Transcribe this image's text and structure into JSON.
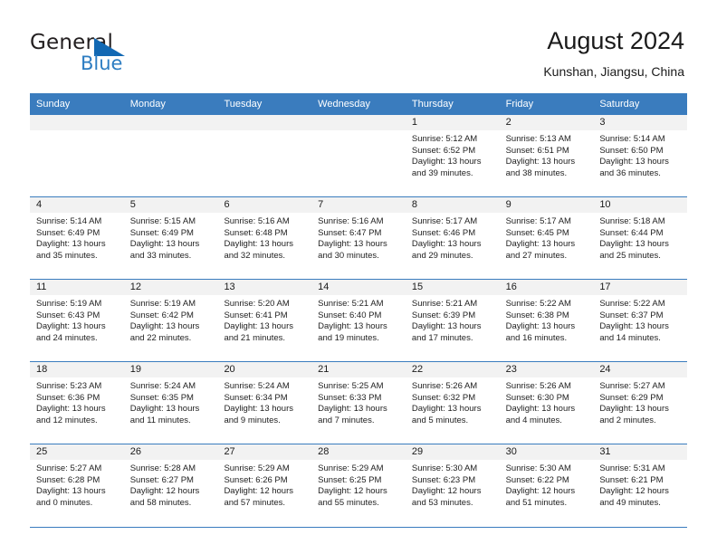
{
  "brand": {
    "name_part1": "General",
    "name_part2": "Blue",
    "logo_icon": "blue-triangle-icon",
    "accent_color": "#1268b3",
    "text_color": "#231f20"
  },
  "header": {
    "title": "August 2024",
    "subtitle": "Kunshan, Jiangsu, China"
  },
  "calendar": {
    "header_bg": "#3a7cbe",
    "header_text_color": "#ffffff",
    "daynum_bg": "#f2f2f2",
    "weekdays": [
      "Sunday",
      "Monday",
      "Tuesday",
      "Wednesday",
      "Thursday",
      "Friday",
      "Saturday"
    ],
    "weeks": [
      [
        {
          "day": "",
          "sunrise": "",
          "sunset": "",
          "daylight1": "",
          "daylight2": ""
        },
        {
          "day": "",
          "sunrise": "",
          "sunset": "",
          "daylight1": "",
          "daylight2": ""
        },
        {
          "day": "",
          "sunrise": "",
          "sunset": "",
          "daylight1": "",
          "daylight2": ""
        },
        {
          "day": "",
          "sunrise": "",
          "sunset": "",
          "daylight1": "",
          "daylight2": ""
        },
        {
          "day": "1",
          "sunrise": "Sunrise: 5:12 AM",
          "sunset": "Sunset: 6:52 PM",
          "daylight1": "Daylight: 13 hours",
          "daylight2": "and 39 minutes."
        },
        {
          "day": "2",
          "sunrise": "Sunrise: 5:13 AM",
          "sunset": "Sunset: 6:51 PM",
          "daylight1": "Daylight: 13 hours",
          "daylight2": "and 38 minutes."
        },
        {
          "day": "3",
          "sunrise": "Sunrise: 5:14 AM",
          "sunset": "Sunset: 6:50 PM",
          "daylight1": "Daylight: 13 hours",
          "daylight2": "and 36 minutes."
        }
      ],
      [
        {
          "day": "4",
          "sunrise": "Sunrise: 5:14 AM",
          "sunset": "Sunset: 6:49 PM",
          "daylight1": "Daylight: 13 hours",
          "daylight2": "and 35 minutes."
        },
        {
          "day": "5",
          "sunrise": "Sunrise: 5:15 AM",
          "sunset": "Sunset: 6:49 PM",
          "daylight1": "Daylight: 13 hours",
          "daylight2": "and 33 minutes."
        },
        {
          "day": "6",
          "sunrise": "Sunrise: 5:16 AM",
          "sunset": "Sunset: 6:48 PM",
          "daylight1": "Daylight: 13 hours",
          "daylight2": "and 32 minutes."
        },
        {
          "day": "7",
          "sunrise": "Sunrise: 5:16 AM",
          "sunset": "Sunset: 6:47 PM",
          "daylight1": "Daylight: 13 hours",
          "daylight2": "and 30 minutes."
        },
        {
          "day": "8",
          "sunrise": "Sunrise: 5:17 AM",
          "sunset": "Sunset: 6:46 PM",
          "daylight1": "Daylight: 13 hours",
          "daylight2": "and 29 minutes."
        },
        {
          "day": "9",
          "sunrise": "Sunrise: 5:17 AM",
          "sunset": "Sunset: 6:45 PM",
          "daylight1": "Daylight: 13 hours",
          "daylight2": "and 27 minutes."
        },
        {
          "day": "10",
          "sunrise": "Sunrise: 5:18 AM",
          "sunset": "Sunset: 6:44 PM",
          "daylight1": "Daylight: 13 hours",
          "daylight2": "and 25 minutes."
        }
      ],
      [
        {
          "day": "11",
          "sunrise": "Sunrise: 5:19 AM",
          "sunset": "Sunset: 6:43 PM",
          "daylight1": "Daylight: 13 hours",
          "daylight2": "and 24 minutes."
        },
        {
          "day": "12",
          "sunrise": "Sunrise: 5:19 AM",
          "sunset": "Sunset: 6:42 PM",
          "daylight1": "Daylight: 13 hours",
          "daylight2": "and 22 minutes."
        },
        {
          "day": "13",
          "sunrise": "Sunrise: 5:20 AM",
          "sunset": "Sunset: 6:41 PM",
          "daylight1": "Daylight: 13 hours",
          "daylight2": "and 21 minutes."
        },
        {
          "day": "14",
          "sunrise": "Sunrise: 5:21 AM",
          "sunset": "Sunset: 6:40 PM",
          "daylight1": "Daylight: 13 hours",
          "daylight2": "and 19 minutes."
        },
        {
          "day": "15",
          "sunrise": "Sunrise: 5:21 AM",
          "sunset": "Sunset: 6:39 PM",
          "daylight1": "Daylight: 13 hours",
          "daylight2": "and 17 minutes."
        },
        {
          "day": "16",
          "sunrise": "Sunrise: 5:22 AM",
          "sunset": "Sunset: 6:38 PM",
          "daylight1": "Daylight: 13 hours",
          "daylight2": "and 16 minutes."
        },
        {
          "day": "17",
          "sunrise": "Sunrise: 5:22 AM",
          "sunset": "Sunset: 6:37 PM",
          "daylight1": "Daylight: 13 hours",
          "daylight2": "and 14 minutes."
        }
      ],
      [
        {
          "day": "18",
          "sunrise": "Sunrise: 5:23 AM",
          "sunset": "Sunset: 6:36 PM",
          "daylight1": "Daylight: 13 hours",
          "daylight2": "and 12 minutes."
        },
        {
          "day": "19",
          "sunrise": "Sunrise: 5:24 AM",
          "sunset": "Sunset: 6:35 PM",
          "daylight1": "Daylight: 13 hours",
          "daylight2": "and 11 minutes."
        },
        {
          "day": "20",
          "sunrise": "Sunrise: 5:24 AM",
          "sunset": "Sunset: 6:34 PM",
          "daylight1": "Daylight: 13 hours",
          "daylight2": "and 9 minutes."
        },
        {
          "day": "21",
          "sunrise": "Sunrise: 5:25 AM",
          "sunset": "Sunset: 6:33 PM",
          "daylight1": "Daylight: 13 hours",
          "daylight2": "and 7 minutes."
        },
        {
          "day": "22",
          "sunrise": "Sunrise: 5:26 AM",
          "sunset": "Sunset: 6:32 PM",
          "daylight1": "Daylight: 13 hours",
          "daylight2": "and 5 minutes."
        },
        {
          "day": "23",
          "sunrise": "Sunrise: 5:26 AM",
          "sunset": "Sunset: 6:30 PM",
          "daylight1": "Daylight: 13 hours",
          "daylight2": "and 4 minutes."
        },
        {
          "day": "24",
          "sunrise": "Sunrise: 5:27 AM",
          "sunset": "Sunset: 6:29 PM",
          "daylight1": "Daylight: 13 hours",
          "daylight2": "and 2 minutes."
        }
      ],
      [
        {
          "day": "25",
          "sunrise": "Sunrise: 5:27 AM",
          "sunset": "Sunset: 6:28 PM",
          "daylight1": "Daylight: 13 hours",
          "daylight2": "and 0 minutes."
        },
        {
          "day": "26",
          "sunrise": "Sunrise: 5:28 AM",
          "sunset": "Sunset: 6:27 PM",
          "daylight1": "Daylight: 12 hours",
          "daylight2": "and 58 minutes."
        },
        {
          "day": "27",
          "sunrise": "Sunrise: 5:29 AM",
          "sunset": "Sunset: 6:26 PM",
          "daylight1": "Daylight: 12 hours",
          "daylight2": "and 57 minutes."
        },
        {
          "day": "28",
          "sunrise": "Sunrise: 5:29 AM",
          "sunset": "Sunset: 6:25 PM",
          "daylight1": "Daylight: 12 hours",
          "daylight2": "and 55 minutes."
        },
        {
          "day": "29",
          "sunrise": "Sunrise: 5:30 AM",
          "sunset": "Sunset: 6:23 PM",
          "daylight1": "Daylight: 12 hours",
          "daylight2": "and 53 minutes."
        },
        {
          "day": "30",
          "sunrise": "Sunrise: 5:30 AM",
          "sunset": "Sunset: 6:22 PM",
          "daylight1": "Daylight: 12 hours",
          "daylight2": "and 51 minutes."
        },
        {
          "day": "31",
          "sunrise": "Sunrise: 5:31 AM",
          "sunset": "Sunset: 6:21 PM",
          "daylight1": "Daylight: 12 hours",
          "daylight2": "and 49 minutes."
        }
      ]
    ]
  }
}
